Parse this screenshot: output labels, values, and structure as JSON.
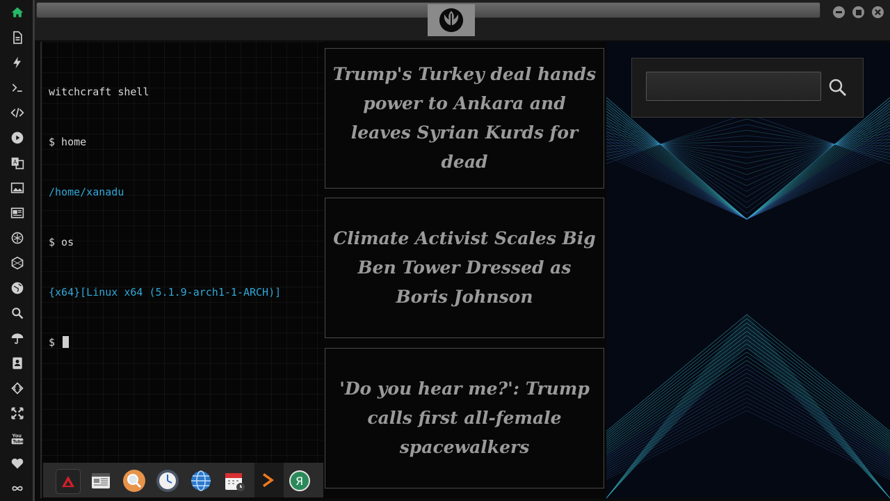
{
  "sidebar": {
    "items": [
      {
        "name": "home-icon"
      },
      {
        "name": "document-icon"
      },
      {
        "name": "lightning-icon"
      },
      {
        "name": "terminal-icon"
      },
      {
        "name": "code-icon"
      },
      {
        "name": "play-icon"
      },
      {
        "name": "translate-icon"
      },
      {
        "name": "image-icon"
      },
      {
        "name": "newspaper-icon"
      },
      {
        "name": "rebel-alliance-icon"
      },
      {
        "name": "hexagon-network-icon"
      },
      {
        "name": "globe-icon"
      },
      {
        "name": "search-icon"
      },
      {
        "name": "umbrella-icon"
      },
      {
        "name": "contacts-icon"
      },
      {
        "name": "diamond-code-icon"
      },
      {
        "name": "expand-icon"
      },
      {
        "name": "youtube-icon"
      },
      {
        "name": "heart-icon"
      },
      {
        "name": "infinity-icon"
      }
    ],
    "active_color": "#27b866"
  },
  "terminal": {
    "lines": [
      {
        "text": "witchcraft shell",
        "style": "normal"
      },
      {
        "text": "$ home",
        "style": "normal"
      },
      {
        "text": "/home/xanadu",
        "style": "cyan"
      },
      {
        "text": "$ os",
        "style": "normal"
      },
      {
        "text": "{x64}[Linux x64 (5.1.9-arch1-1-ARCH)]",
        "style": "cyan"
      },
      {
        "text": "$ ",
        "style": "prompt"
      }
    ]
  },
  "dock": {
    "apps": [
      {
        "name": "app-launcher-icon"
      },
      {
        "name": "news-reader-icon"
      },
      {
        "name": "search-app-icon"
      },
      {
        "name": "clock-app-icon"
      },
      {
        "name": "browser-globe-icon"
      },
      {
        "name": "calendar-app-icon"
      },
      {
        "name": "media-play-icon"
      },
      {
        "name": "yandex-icon"
      }
    ]
  },
  "news": {
    "headlines": [
      "Trump's Turkey deal hands power to Ankara and leaves Syrian Kurds for dead",
      "Climate Activist Scales Big Ben Tower Dressed as Boris Johnson",
      "'Do you hear me?': Trump calls first all-female spacewalkers"
    ]
  },
  "search": {
    "value": "",
    "placeholder": ""
  },
  "colors": {
    "terminal_cyan": "#2fa8d8",
    "headline_gray": "#9a9a9a",
    "pattern_blue": "#3f7fd0",
    "pattern_teal": "#3bb6c8"
  }
}
